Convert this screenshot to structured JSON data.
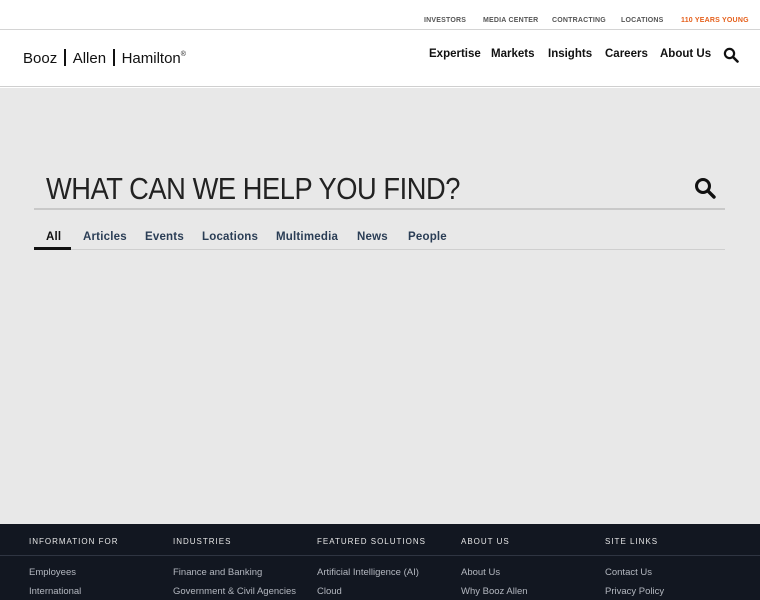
{
  "utility_nav": {
    "investors": "INVESTORS",
    "media_center": "MEDIA CENTER",
    "contracting": "CONTRACTING",
    "locations": "LOCATIONS",
    "years_young": "110 YEARS YOUNG"
  },
  "colors": {
    "accent": "#e5601c",
    "footer_bg": "#121721",
    "main_bg": "#e8e8e8"
  },
  "logo": {
    "part1": "Booz",
    "part2": "Allen",
    "part3": "Hamilton",
    "mark": "®"
  },
  "main_nav": {
    "expertise": "Expertise",
    "markets": "Markets",
    "insights": "Insights",
    "careers": "Careers",
    "about_us": "About Us",
    "search_icon": "search-icon"
  },
  "search": {
    "placeholder": "WHAT CAN WE HELP YOU FIND?"
  },
  "tabs": [
    "All",
    "Articles",
    "Events",
    "Locations",
    "Multimedia",
    "News",
    "People"
  ],
  "footer": {
    "columns": [
      {
        "title": "INFORMATION FOR",
        "links": [
          "Employees",
          "International"
        ]
      },
      {
        "title": "INDUSTRIES",
        "links": [
          "Finance and Banking",
          "Government & Civil Agencies"
        ]
      },
      {
        "title": "FEATURED SOLUTIONS",
        "links": [
          "Artificial Intelligence (AI)",
          "Cloud"
        ]
      },
      {
        "title": "ABOUT US",
        "links": [
          "About Us",
          "Why Booz Allen"
        ]
      },
      {
        "title": "SITE LINKS",
        "links": [
          "Contact Us",
          "Privacy Policy"
        ]
      }
    ]
  }
}
